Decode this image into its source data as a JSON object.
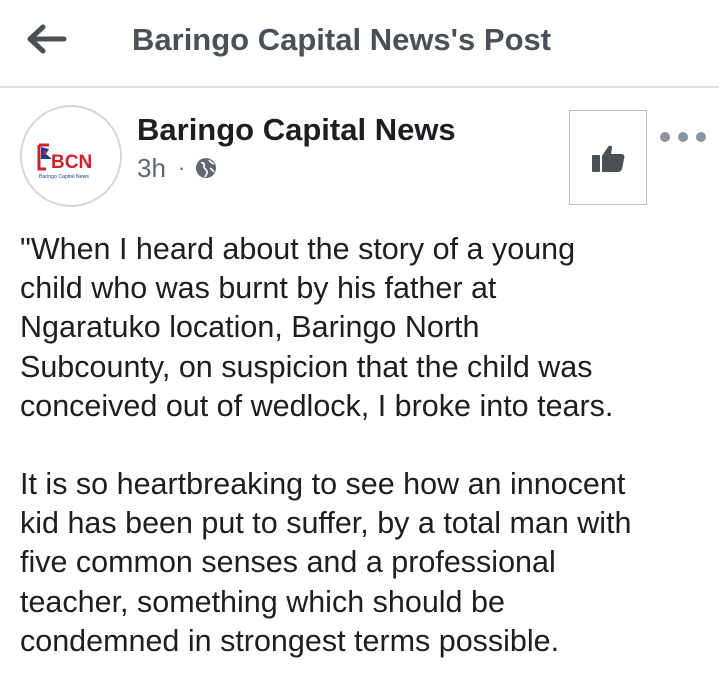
{
  "header": {
    "title": "Baringo Capital News's Post",
    "back_icon": "arrow-left-icon"
  },
  "post": {
    "page_name": "Baringo Capital News",
    "avatar": {
      "logo_text": "BCN",
      "logo_subtext": "Baringo Capital News"
    },
    "time": "3h",
    "separator": "·",
    "audience_icon": "globe-icon",
    "like_icon": "thumbs-up-icon",
    "more_icon": "more-dots-icon",
    "paragraphs": [
      [
        "\"When I heard about the story of a young",
        "child who was burnt by his father at",
        "Ngaratuko location, Baringo North",
        "Subcounty, on suspicion that the child was",
        "conceived out of wedlock, I broke into tears."
      ],
      [
        "It is so heartbreaking to see how an innocent",
        "kid has been put to suffer, by a total man with",
        "five common senses and a professional",
        "teacher, something which should be",
        "condemned in strongest terms possible."
      ]
    ]
  },
  "colors": {
    "title_gray": "#4b4f56",
    "meta_gray": "#606770",
    "logo_red": "#d0202a",
    "logo_blue": "#1a3e8c",
    "divider": "#dadde1"
  }
}
